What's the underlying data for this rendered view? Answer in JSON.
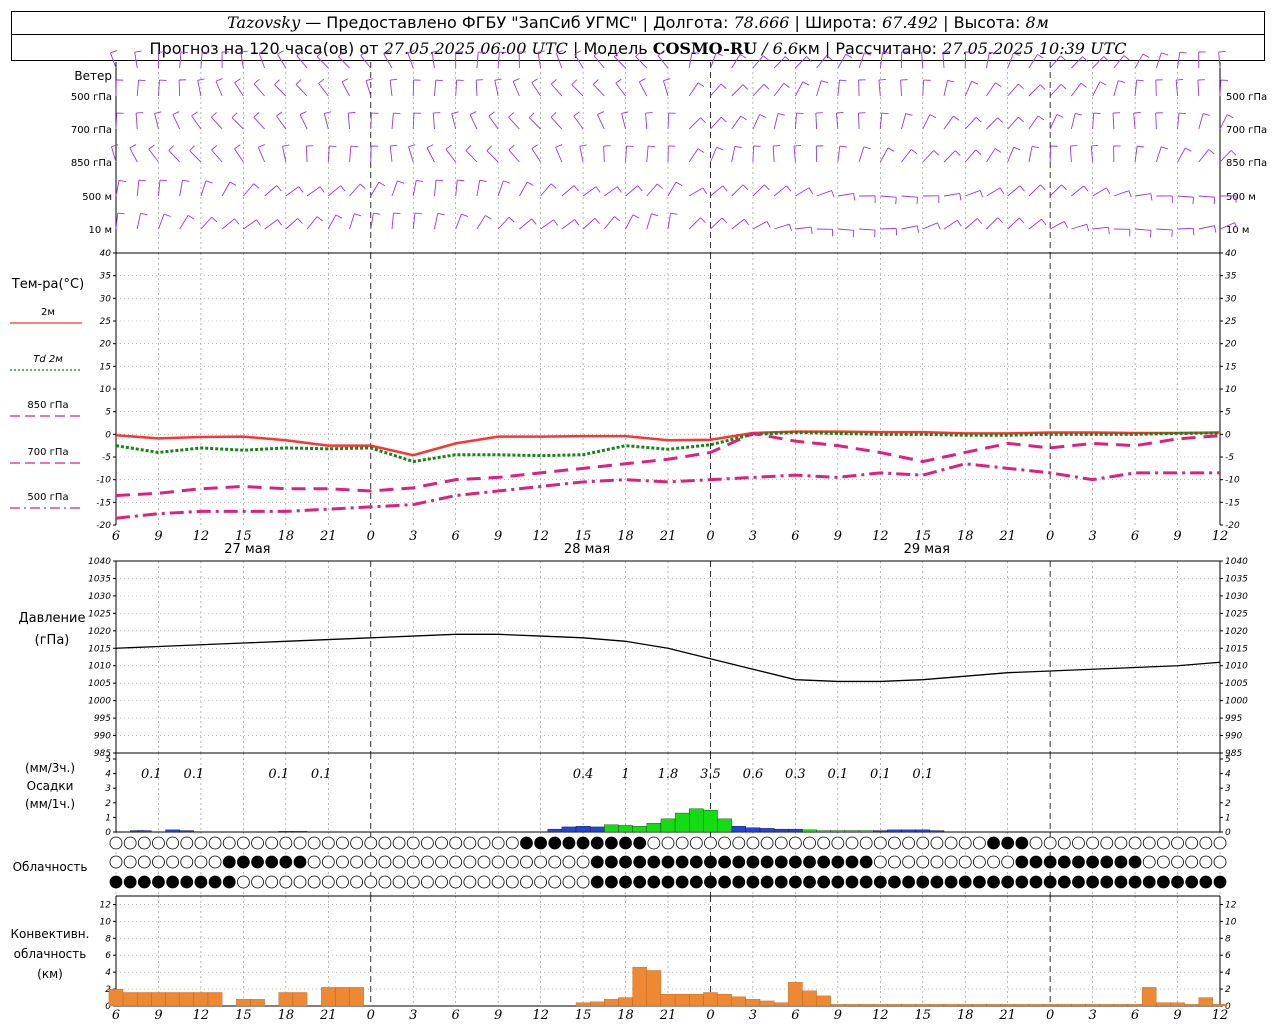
{
  "header": {
    "station": "Tazovsky",
    "provider": "— Предоставлено ФГБУ \"ЗапСиб УГМС\"",
    "lon_label": "Долгота:",
    "lon": "78.666",
    "lat_label": "Широта:",
    "lat": "67.492",
    "alt_label": "Высота:",
    "alt": "8м",
    "forecast_label": "Прогноз на 120 часа(ов) от",
    "forecast_start": "27.05.2025 06:00 UTC",
    "model_label": "Модель",
    "model": "COSMO-RU",
    "resolution": "/ 6.6",
    "res_unit": "км",
    "calc_label": "Рассчитано:",
    "calc_time": "27.05.2025 10:39 UTC"
  },
  "time_axis": {
    "hour_labels": [
      "6",
      "9",
      "12",
      "15",
      "18",
      "21",
      "0",
      "3",
      "6",
      "9",
      "12",
      "15",
      "18",
      "21",
      "0",
      "3",
      "6",
      "9",
      "12",
      "15",
      "18",
      "21",
      "0",
      "3",
      "6",
      "9",
      "12"
    ],
    "day_labels": [
      "27 мая",
      "28 мая",
      "29 мая"
    ]
  },
  "wind_panel": {
    "title": "Ветер",
    "levels": [
      "500 гПа",
      "700 гПа",
      "850 гПа",
      "500 м",
      "10 м"
    ],
    "color": "#9933ff"
  },
  "temperature_panel": {
    "title": "Тем-ра(°C)",
    "legend": [
      {
        "label": "2м",
        "color": "#ff3333",
        "style": "solid"
      },
      {
        "label": "Td 2м",
        "color": "#118811",
        "style": "dotted"
      },
      {
        "label": "850 гПа",
        "color": "#e0207a",
        "style": "dashed"
      },
      {
        "label": "700 гПа",
        "color": "#e0207a",
        "style": "dashed"
      },
      {
        "label": "500 гПа",
        "color": "#e0207a",
        "style": "dashdot"
      }
    ]
  },
  "pressure_panel": {
    "title": "Давление",
    "unit": "(гПа)"
  },
  "precip_panel": {
    "unit3h": "(мм/3ч.)",
    "title": "Осадки",
    "unit1h": "(мм/1ч.)",
    "labels": [
      "0.1",
      "0.1",
      "0.1",
      "0.1",
      "0.4",
      "1",
      "1.8",
      "3.5",
      "0.6",
      "0.3",
      "0.1",
      "0.1",
      "0.1"
    ],
    "label_hours": [
      3.5,
      6.5,
      12.5,
      15.5,
      34,
      37,
      40,
      43,
      46,
      49,
      52,
      55,
      58
    ]
  },
  "cloud_panel": {
    "title": "Облачность"
  },
  "conv_panel": {
    "title": "Конвективн.",
    "title2": "облачность",
    "unit": "(км)"
  },
  "chart_data": [
    {
      "type": "line",
      "title": "Тем-ра(°C)",
      "x_unit": "hours from 27.05.2025 06:00 UTC",
      "ylim": [
        -20,
        40
      ],
      "yticks": [
        -20,
        -15,
        -10,
        -5,
        0,
        5,
        10,
        15,
        20,
        25,
        30,
        35,
        40
      ],
      "series": [
        {
          "name": "2м",
          "x": [
            0,
            3,
            6,
            9,
            12,
            15,
            18,
            21,
            24,
            27,
            30,
            33,
            36,
            39,
            42,
            45,
            48,
            51,
            54,
            57,
            60,
            63,
            66,
            69,
            72,
            75,
            78
          ],
          "values": [
            -0.2,
            -0.9,
            -0.6,
            -0.5,
            -1.3,
            -2.5,
            -2.5,
            -4.6,
            -2.0,
            -0.5,
            -0.5,
            -0.4,
            -0.4,
            -1.3,
            -1.2,
            0.3,
            0.6,
            0.6,
            0.5,
            0.5,
            0.2,
            0.2,
            0.4,
            0.4,
            0.3,
            0.3,
            0.4
          ]
        },
        {
          "name": "Td 2м",
          "x": [
            0,
            3,
            6,
            9,
            12,
            15,
            18,
            21,
            24,
            27,
            30,
            33,
            36,
            39,
            42,
            45,
            48,
            51,
            54,
            57,
            60,
            63,
            66,
            69,
            72,
            75,
            78
          ],
          "values": [
            -2.5,
            -4.0,
            -3.0,
            -3.5,
            -3.0,
            -3.2,
            -3.0,
            -6.0,
            -4.5,
            -4.5,
            -4.7,
            -4.5,
            -2.5,
            -3.3,
            -2.3,
            0.0,
            0.4,
            0.2,
            0.0,
            0.0,
            -0.2,
            -0.2,
            0.0,
            0.0,
            0.0,
            0.2,
            0.3
          ]
        },
        {
          "name": "850 гПа",
          "x": [
            0,
            3,
            6,
            9,
            12,
            15,
            18,
            21,
            24,
            27,
            30,
            33,
            36,
            39,
            42,
            45,
            48,
            51,
            54,
            57,
            60,
            63,
            66,
            69,
            72,
            75,
            78
          ],
          "values": [
            -13.5,
            -13.0,
            -12.0,
            -11.5,
            -12.0,
            -12.0,
            -12.5,
            -11.8,
            -10.0,
            -9.5,
            -8.5,
            -7.5,
            -6.5,
            -5.5,
            -4.0,
            0.2,
            -1.5,
            -2.5,
            -4.0,
            -6.0,
            -4.0,
            -2.0,
            -3.0,
            -2.0,
            -2.5,
            -1.0,
            -0.3
          ]
        },
        {
          "name": "700 гПа",
          "x": [
            0,
            6,
            12,
            18,
            24,
            30,
            36,
            42,
            48,
            54,
            60,
            66,
            72,
            78
          ],
          "values": [
            -13.5,
            -12.5,
            -12.0,
            -12.0,
            -12.5,
            -10.5,
            -8.5,
            -6.0,
            -0.5,
            -1.5,
            -4.0,
            -2.5,
            -2.5,
            -0.3
          ]
        },
        {
          "name": "500 гПа",
          "x": [
            0,
            3,
            6,
            9,
            12,
            15,
            18,
            21,
            24,
            27,
            30,
            33,
            36,
            39,
            42,
            45,
            48,
            51,
            54,
            57,
            60,
            63,
            66,
            69,
            72,
            75,
            78
          ],
          "values": [
            -18.5,
            -17.5,
            -17.0,
            -17.0,
            -17.0,
            -16.5,
            -16.0,
            -15.5,
            -13.5,
            -12.5,
            -11.5,
            -10.5,
            -10.0,
            -10.5,
            -10.0,
            -9.5,
            -9.0,
            -9.5,
            -8.5,
            -9.0,
            -6.5,
            -7.5,
            -8.5,
            -10.0,
            -8.5,
            -8.5,
            -8.5
          ]
        }
      ]
    },
    {
      "type": "line",
      "title": "Давление",
      "ylabel": "(гПа)",
      "ylim": [
        985,
        1040
      ],
      "yticks": [
        985,
        990,
        995,
        1000,
        1005,
        1010,
        1015,
        1020,
        1025,
        1030,
        1035,
        1040
      ],
      "series": [
        {
          "name": "Давление",
          "x": [
            0,
            3,
            6,
            9,
            12,
            15,
            18,
            21,
            24,
            27,
            30,
            33,
            36,
            39,
            42,
            45,
            48,
            51,
            54,
            57,
            60,
            63,
            66,
            69,
            72,
            75,
            78
          ],
          "values": [
            1015,
            1015.5,
            1016,
            1016.5,
            1017,
            1017.5,
            1018,
            1018.5,
            1019,
            1019,
            1018.5,
            1018,
            1017,
            1015,
            1012,
            1009,
            1006,
            1005.5,
            1005.5,
            1006,
            1007,
            1008,
            1008.5,
            1009,
            1009.5,
            1010,
            1011
          ]
        }
      ]
    },
    {
      "type": "bar",
      "title": "Осадки",
      "ylabel": "(мм/1ч.)",
      "ylim": [
        0,
        5
      ],
      "hours": [
        1.5,
        2,
        4,
        5,
        12,
        13,
        31,
        32,
        33,
        34,
        35,
        36,
        37,
        38,
        39,
        40,
        41,
        42,
        43,
        44,
        45,
        46,
        47,
        48,
        49,
        50,
        51,
        52,
        53,
        54,
        55,
        56,
        57,
        58
      ],
      "values": [
        0.1,
        0.1,
        0.15,
        0.1,
        0.05,
        0.05,
        0.2,
        0.35,
        0.4,
        0.35,
        0.5,
        0.45,
        0.4,
        0.6,
        0.9,
        1.3,
        1.6,
        1.5,
        0.9,
        0.4,
        0.3,
        0.25,
        0.2,
        0.2,
        0.15,
        0.1,
        0.1,
        0.1,
        0.1,
        0.1,
        0.15,
        0.15,
        0.15,
        0.1
      ],
      "colors": [
        "blue",
        "blue",
        "blue",
        "blue",
        "blue",
        "blue",
        "blue",
        "blue",
        "blue",
        "blue",
        "green",
        "green",
        "green",
        "green",
        "green",
        "green",
        "green",
        "green",
        "green",
        "blue",
        "blue",
        "blue",
        "blue",
        "blue",
        "green",
        "green",
        "green",
        "green",
        "green",
        "blue",
        "blue",
        "blue",
        "blue",
        "blue"
      ]
    },
    {
      "type": "bar",
      "title": "Конвективн. облачность",
      "ylabel": "(км)",
      "ylim": [
        0,
        13
      ],
      "yticks": [
        0,
        2,
        4,
        6,
        8,
        10,
        12
      ],
      "hours": [
        0,
        1,
        2,
        3,
        4,
        5,
        6,
        7,
        8,
        9,
        10,
        11,
        12,
        13,
        14,
        15,
        16,
        17,
        18,
        19,
        20,
        21,
        22,
        23,
        24,
        33,
        34,
        35,
        36,
        37,
        38,
        39,
        40,
        41,
        42,
        43,
        44,
        45,
        46,
        47,
        48,
        49,
        50,
        51,
        52,
        53,
        54,
        55,
        56,
        57,
        58,
        59,
        60,
        61,
        62,
        63,
        64,
        65,
        66,
        67,
        68,
        69,
        70,
        71,
        72,
        73,
        74,
        75,
        76,
        77,
        78
      ],
      "values": [
        2.0,
        1.6,
        1.6,
        1.6,
        1.6,
        1.6,
        1.6,
        1.6,
        0,
        0.8,
        0.8,
        0,
        1.6,
        1.6,
        0,
        2.2,
        2.2,
        2.2,
        0,
        0,
        0,
        0,
        0,
        0,
        0,
        0.4,
        0.5,
        0.8,
        1.0,
        1.0,
        1.0,
        1.0,
        1.0,
        1.0,
        1.0,
        1.0,
        1.0,
        0,
        0,
        0,
        0,
        0,
        0,
        0,
        0,
        0,
        0,
        0,
        0,
        0,
        0,
        0,
        0,
        0,
        0,
        0,
        0,
        0,
        0,
        0,
        0,
        0,
        0,
        0,
        0,
        0,
        0,
        0,
        0,
        0,
        0
      ],
      "late_hours": [
        37,
        38,
        39,
        40,
        41,
        42,
        43,
        44,
        45,
        46,
        47,
        48,
        49,
        50,
        51,
        52,
        53,
        54,
        55,
        56,
        57,
        58,
        59,
        60,
        61,
        62,
        63,
        64,
        65,
        66,
        67,
        68,
        69,
        70,
        71,
        72,
        73,
        74,
        75,
        76,
        77,
        78
      ],
      "late_values": [
        4.6,
        4.2,
        1.4,
        1.4,
        1.4,
        1.6,
        1.4,
        1.1,
        0.8,
        0.6,
        0.4,
        2.8,
        1.8,
        1.2,
        0.2,
        0.2,
        0.2,
        0.2,
        0.2,
        0.2,
        0.2,
        0.2,
        0.2,
        0.2,
        0.2,
        0.2,
        0.2,
        0.2,
        0.2,
        0.2,
        0.2,
        0.2,
        0.2,
        0.2,
        0.2,
        0.2,
        2.2,
        0.4,
        0.4,
        0.2,
        1.0,
        0.2
      ]
    }
  ]
}
